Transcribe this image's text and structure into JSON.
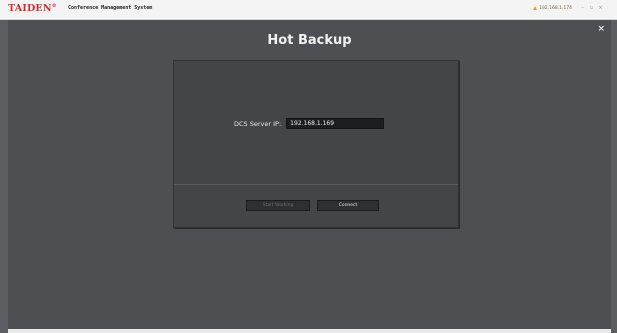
{
  "header": {
    "logo_text": "TAIDEN",
    "logo_mark": "®",
    "app_title": "Conference Management System",
    "ip_address": "192.168.1.174",
    "warning_icon": "warning-icon",
    "window_controls": [
      "–",
      "▫",
      "×"
    ]
  },
  "main": {
    "title": "Hot Backup",
    "close_symbol": "×"
  },
  "dialog": {
    "ip_label": "DCS Server IP:",
    "ip_value": "192.168.1.169",
    "start_button": "Start Working",
    "connect_button": "Connect"
  },
  "colors": {
    "background": "#5b5d61",
    "panel": "#444546",
    "logo": "#d52b2b",
    "warning": "#e3a21a"
  }
}
